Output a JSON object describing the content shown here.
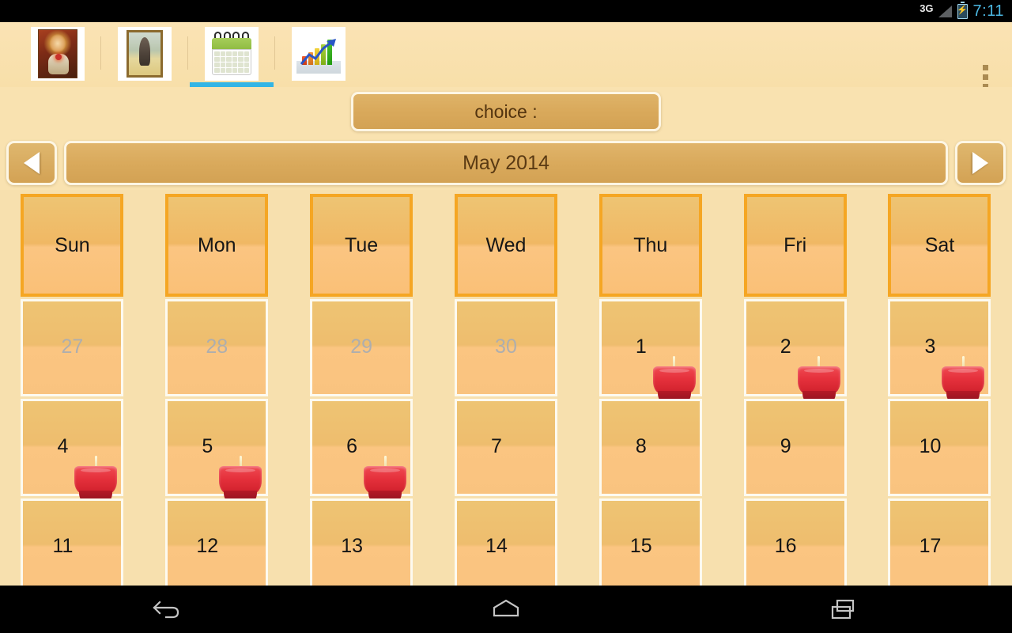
{
  "status_bar": {
    "network": "3G",
    "battery_icon": "battery-charging-icon",
    "time": "7:11"
  },
  "tab_bar": {
    "tabs": [
      {
        "id": "tab-jesus",
        "icon": "jesus-portrait-icon",
        "selected": false
      },
      {
        "id": "tab-mary",
        "icon": "mary-portrait-icon",
        "selected": false
      },
      {
        "id": "tab-calendar",
        "icon": "calendar-icon",
        "selected": true
      },
      {
        "id": "tab-stats",
        "icon": "bar-chart-growth-icon",
        "selected": false
      }
    ],
    "overflow_icon": "overflow-menu-icon",
    "selected_indicator_color": "#33b5e5"
  },
  "choice": {
    "label": "choice :"
  },
  "month_nav": {
    "prev_icon": "previous-month-arrow-icon",
    "next_icon": "next-month-arrow-icon",
    "title": "May 2014"
  },
  "calendar": {
    "day_headers": [
      "Sun",
      "Mon",
      "Tue",
      "Wed",
      "Thu",
      "Fri",
      "Sat"
    ],
    "weeks": [
      [
        {
          "day": "27",
          "muted": true,
          "candle": false
        },
        {
          "day": "28",
          "muted": true,
          "candle": false
        },
        {
          "day": "29",
          "muted": true,
          "candle": false
        },
        {
          "day": "30",
          "muted": true,
          "candle": false
        },
        {
          "day": "1",
          "muted": false,
          "candle": true
        },
        {
          "day": "2",
          "muted": false,
          "candle": true
        },
        {
          "day": "3",
          "muted": false,
          "candle": true
        }
      ],
      [
        {
          "day": "4",
          "muted": false,
          "candle": true
        },
        {
          "day": "5",
          "muted": false,
          "candle": true
        },
        {
          "day": "6",
          "muted": false,
          "candle": true
        },
        {
          "day": "7",
          "muted": false,
          "candle": false
        },
        {
          "day": "8",
          "muted": false,
          "candle": false
        },
        {
          "day": "9",
          "muted": false,
          "candle": false
        },
        {
          "day": "10",
          "muted": false,
          "candle": false
        }
      ],
      [
        {
          "day": "11",
          "muted": false,
          "candle": false
        },
        {
          "day": "12",
          "muted": false,
          "candle": false
        },
        {
          "day": "13",
          "muted": false,
          "candle": false
        },
        {
          "day": "14",
          "muted": false,
          "candle": false
        },
        {
          "day": "15",
          "muted": false,
          "candle": false
        },
        {
          "day": "16",
          "muted": false,
          "candle": false
        },
        {
          "day": "17",
          "muted": false,
          "candle": false
        }
      ]
    ],
    "candle_icon": "red-votive-candle-icon"
  },
  "nav_bar": {
    "buttons": [
      {
        "id": "nav-back",
        "icon": "back-arrow-icon"
      },
      {
        "id": "nav-home",
        "icon": "home-icon"
      },
      {
        "id": "nav-recents",
        "icon": "recent-apps-icon"
      }
    ]
  },
  "colors": {
    "page_background": "#f7e0ae",
    "panel_background": "#f9e2b0",
    "accent_orange": "#f5a623",
    "button_gold": "#d9a95b",
    "tab_selected": "#33b5e5",
    "candle_red": "#e5313c",
    "muted_text": "#aeaeae"
  }
}
